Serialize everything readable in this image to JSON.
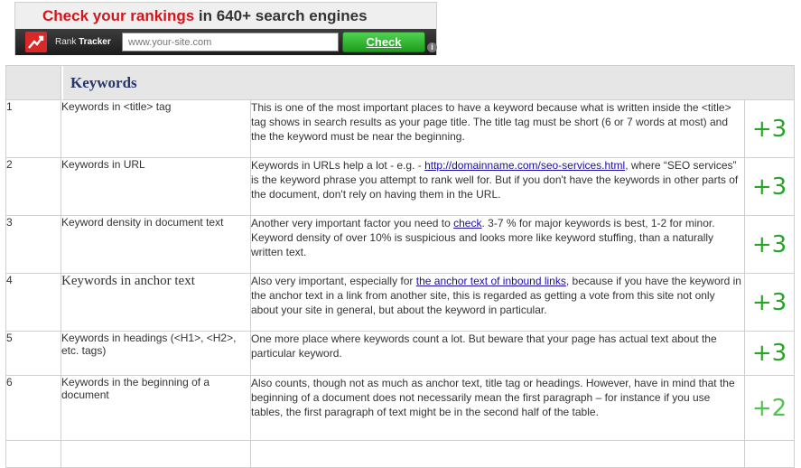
{
  "banner": {
    "headline_red": "Check your rankings",
    "headline_rest": " in 640+ search engines",
    "brand_prefix": "Rank ",
    "brand_name": "Tracker",
    "url_placeholder": "www.your-site.com",
    "check_label": "Check",
    "info_glyph": "i"
  },
  "table": {
    "header": "Keywords",
    "rows": [
      {
        "num": "1",
        "name": "Keywords in <title> tag",
        "desc": "This is one of the most important places to have a keyword because what is written inside the <title> tag shows in search results as your page title. The title tag must be short (6 or 7 words at most) and the the keyword must be near the beginning.",
        "score": "+3"
      },
      {
        "num": "2",
        "name": "Keywords in URL",
        "desc_before": "Keywords in URLs help a lot - e.g. - ",
        "desc_link": "http://domainname.com/seo-services.html",
        "desc_after": ", where “SEO services” is the keyword phrase you attempt to rank well for. But if you don't have the keywords in other parts of the document, don't rely on having them in the URL.",
        "score": "+3"
      },
      {
        "num": "3",
        "name": "Keyword density in document text",
        "desc_before": "Another very important factor you need to ",
        "desc_link": "check",
        "desc_after": ". 3-7 % for major keywords is best, 1-2 for minor. Keyword density of over 10% is suspicious and looks more like keyword stuffing, than a naturally written text.",
        "score": "+3"
      },
      {
        "num": "4",
        "name": "Keywords in anchor text",
        "desc_before": "Also very important, especially for ",
        "desc_link": "the anchor text of inbound links",
        "desc_after": ", because if you have the keyword in the anchor text in a link from another site, this is regarded as getting a vote from this site not only about your site in general, but about the keyword in particular.",
        "score": "+3"
      },
      {
        "num": "5",
        "name": "Keywords in headings (<H1>, <H2>, etc. tags)",
        "desc": "One more place where keywords count a lot. But beware that your page has actual text about the particular keyword.",
        "score": "+3"
      },
      {
        "num": "6",
        "name": "Keywords in the beginning of a document",
        "desc": "Also counts, though not as much as anchor text, title tag or headings. However, have in mind that the beginning of a document does not necessarily mean the first paragraph – for instance if you use tables, the first paragraph of text might be in the second half of the table.",
        "score": "+2"
      }
    ]
  },
  "colors": {
    "banner_red": "#d0171c",
    "header_bg": "#e6e6e6",
    "header_text": "#26366a",
    "score_green": "#26a526",
    "score_light_green": "#4fc34f",
    "link": "#1a0dab"
  }
}
